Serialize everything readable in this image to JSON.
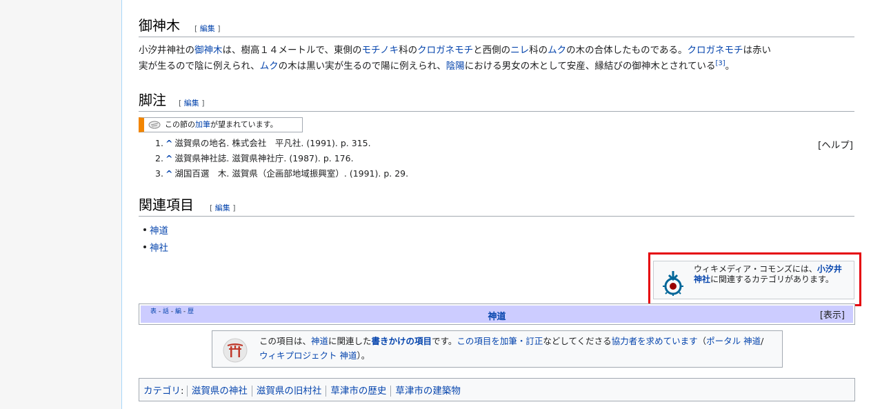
{
  "sections": {
    "goshinboku": {
      "title": "御神木",
      "edit": "編集",
      "text": {
        "t1": "小汐井神社の",
        "l1": "御神木",
        "t2": "は、樹高１４メートルで、東側の",
        "l2": "モチノキ",
        "t3": "科の",
        "l3": "クロガネモチ",
        "t4": "と西側の",
        "l4": "ニレ",
        "t5": "科の",
        "l5": "ムク",
        "t6": "の木の合体したものである。",
        "l6": "クロガネモチ",
        "t7": "は赤い",
        "t8": "実が生るので陰に例えられ、",
        "l7": "ムク",
        "t9": "の木は黒い実が生るので陽に例えられ、",
        "l8": "陰陽",
        "t10": "における男女の木として安産、縁結びの御神木とされている",
        "ref": "[3]",
        "t11": "。"
      }
    },
    "footnotes": {
      "title": "脚注",
      "edit": "編集",
      "notice": {
        "pre": "この節の",
        "link": "加筆",
        "post": "が望まれています。"
      },
      "help": "[ヘルプ]",
      "refs": [
        {
          "num": "1.",
          "caret": "^",
          "text": "滋賀県の地名. 株式会社　平凡社. (1991). p. 315."
        },
        {
          "num": "2.",
          "caret": "^",
          "text": "滋賀県神社誌. 滋賀県神社庁. (1987). p. 176."
        },
        {
          "num": "3.",
          "caret": "^",
          "text": "湖国百選　木. 滋賀県（企画部地域振興室）. (1991). p. 29."
        }
      ]
    },
    "related": {
      "title": "関連項目",
      "edit": "編集",
      "items": [
        "神道",
        "神社"
      ]
    }
  },
  "commons": {
    "pre": "ウィキメディア・コモンズには、",
    "link": "小汐井神社",
    "post": "に関連するカテゴリがあります。"
  },
  "navbox": {
    "vte": [
      "表",
      "話",
      "編",
      "歴"
    ],
    "title": "神道",
    "show": "[表示]"
  },
  "stub": {
    "t1": "この項目は、",
    "l1": "神道",
    "t2": "に関連した",
    "b1": "書きかけの項目",
    "t3": "です。",
    "l2": "この項目を加筆・訂正",
    "t4": "などしてくださる",
    "l3": "協力者を求めています",
    "t5": "（",
    "l4": "ポータル 神道",
    "t6": "/",
    "l5": "ウィキプロジェクト 神道",
    "t7": "）。"
  },
  "categories": {
    "label": "カテゴリ",
    "items": [
      "滋賀県の神社",
      "滋賀県の旧村社",
      "草津市の歴史",
      "草津市の建築物"
    ]
  },
  "colors": {
    "link": "#0645ad",
    "notice_bar": "#f28500",
    "highlight": "#e5000a",
    "navbox_title_bg": "#ccccff"
  }
}
